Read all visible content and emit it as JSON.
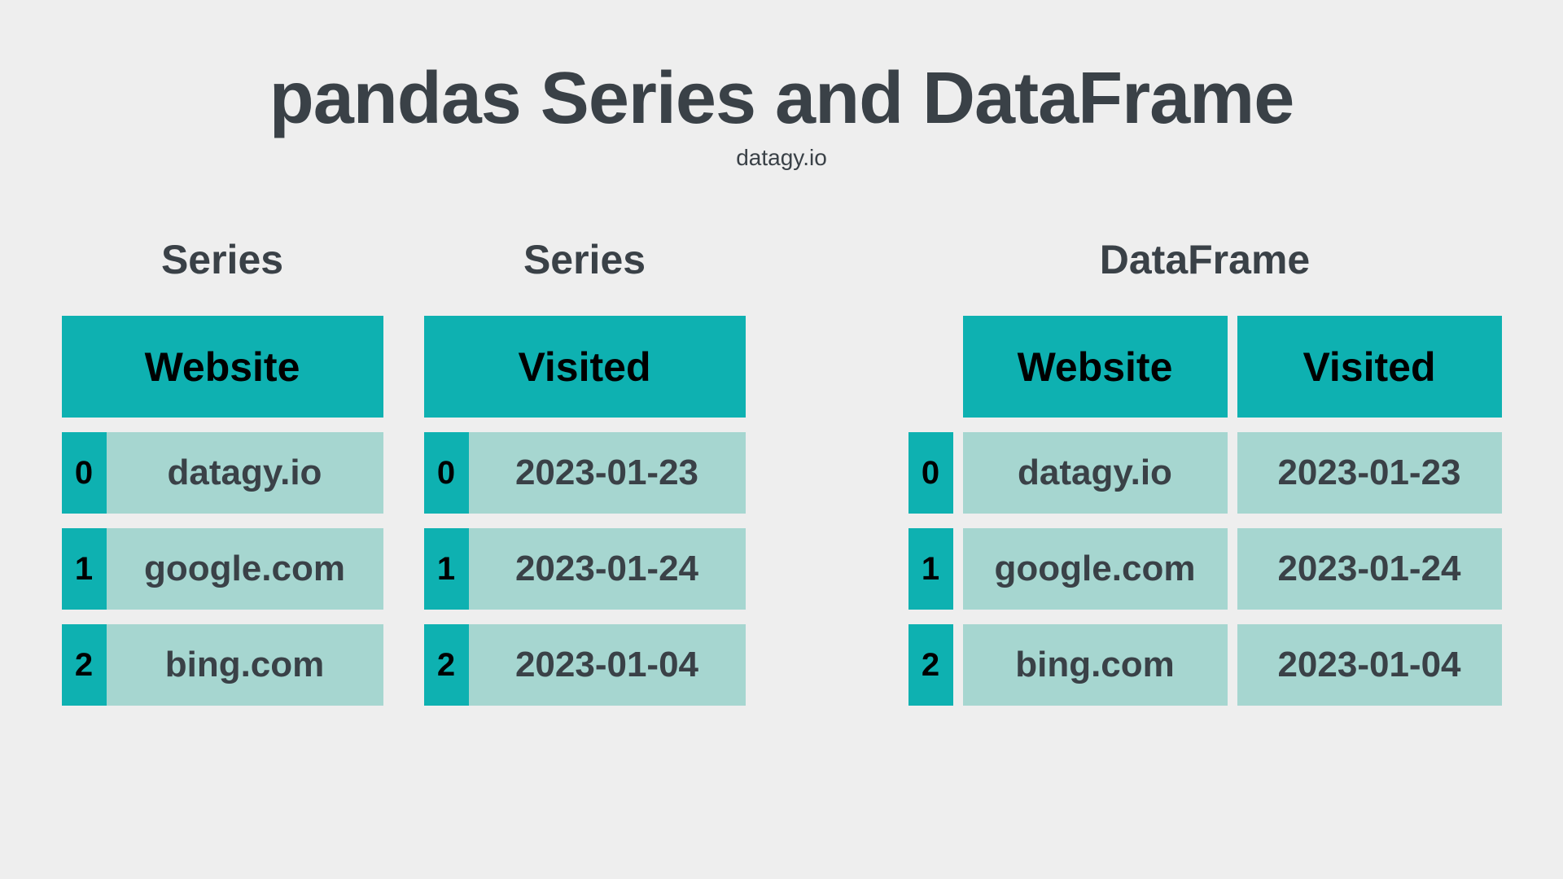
{
  "title": "pandas Series and DataFrame",
  "subtitle": "datagy.io",
  "series1": {
    "label": "Series",
    "header": "Website",
    "rows": [
      {
        "index": "0",
        "value": "datagy.io"
      },
      {
        "index": "1",
        "value": "google.com"
      },
      {
        "index": "2",
        "value": "bing.com"
      }
    ]
  },
  "series2": {
    "label": "Series",
    "header": "Visited",
    "rows": [
      {
        "index": "0",
        "value": "2023-01-23"
      },
      {
        "index": "1",
        "value": "2023-01-24"
      },
      {
        "index": "2",
        "value": "2023-01-04"
      }
    ]
  },
  "dataframe": {
    "label": "DataFrame",
    "headers": [
      "Website",
      "Visited"
    ],
    "rows": [
      {
        "index": "0",
        "values": [
          "datagy.io",
          "2023-01-23"
        ]
      },
      {
        "index": "1",
        "values": [
          "google.com",
          "2023-01-24"
        ]
      },
      {
        "index": "2",
        "values": [
          "bing.com",
          "2023-01-04"
        ]
      }
    ]
  },
  "chart_data": {
    "type": "table",
    "title": "pandas Series and DataFrame",
    "series": [
      {
        "name": "Website",
        "values": [
          "datagy.io",
          "google.com",
          "bing.com"
        ]
      },
      {
        "name": "Visited",
        "values": [
          "2023-01-23",
          "2023-01-24",
          "2023-01-04"
        ]
      }
    ],
    "dataframe": {
      "columns": [
        "Website",
        "Visited"
      ],
      "index": [
        0,
        1,
        2
      ],
      "data": [
        [
          "datagy.io",
          "2023-01-23"
        ],
        [
          "google.com",
          "2023-01-24"
        ],
        [
          "bing.com",
          "2023-01-04"
        ]
      ]
    }
  }
}
